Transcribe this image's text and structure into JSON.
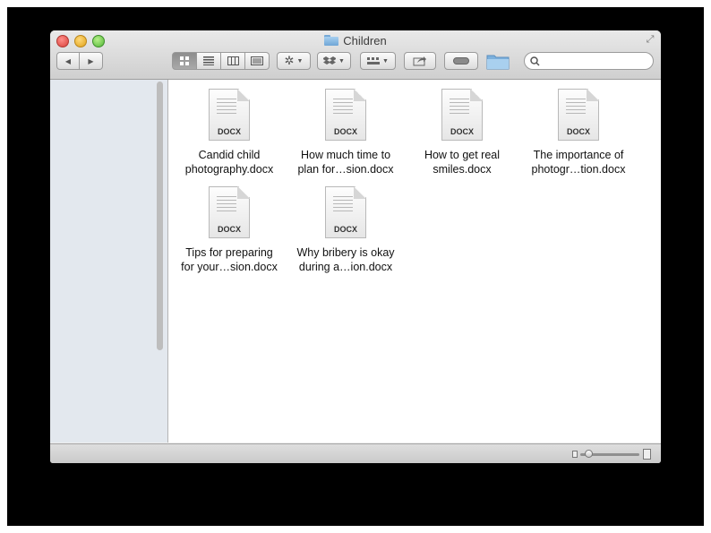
{
  "window": {
    "title": "Children"
  },
  "toolbar": {
    "back_icon": "◀",
    "forward_icon": "▶",
    "view_buttons": [
      "icon-view",
      "list-view",
      "column-view",
      "coverflow-view"
    ],
    "action_icon": "gear",
    "dropbox_icon": "dropbox",
    "arrange_icon": "arrange",
    "share_icon": "share",
    "tag_icon": "toggle",
    "folder_icon": "folder",
    "search_placeholder": ""
  },
  "files": [
    {
      "name_line1": "Candid child",
      "name_line2": "photography.docx",
      "badge": "DOCX"
    },
    {
      "name_line1": "How much time to",
      "name_line2": "plan for…sion.docx",
      "badge": "DOCX"
    },
    {
      "name_line1": "How to get real",
      "name_line2": "smiles.docx",
      "badge": "DOCX"
    },
    {
      "name_line1": "The importance of",
      "name_line2": "photogr…tion.docx",
      "badge": "DOCX"
    },
    {
      "name_line1": "Tips for preparing",
      "name_line2": "for your…sion.docx",
      "badge": "DOCX"
    },
    {
      "name_line1": "Why bribery is okay",
      "name_line2": "during a…ion.docx",
      "badge": "DOCX"
    }
  ],
  "colors": {
    "window_bg": "#ececec",
    "sidebar_bg": "#e3e8ee",
    "folder_blue": "#6fa6d6"
  }
}
